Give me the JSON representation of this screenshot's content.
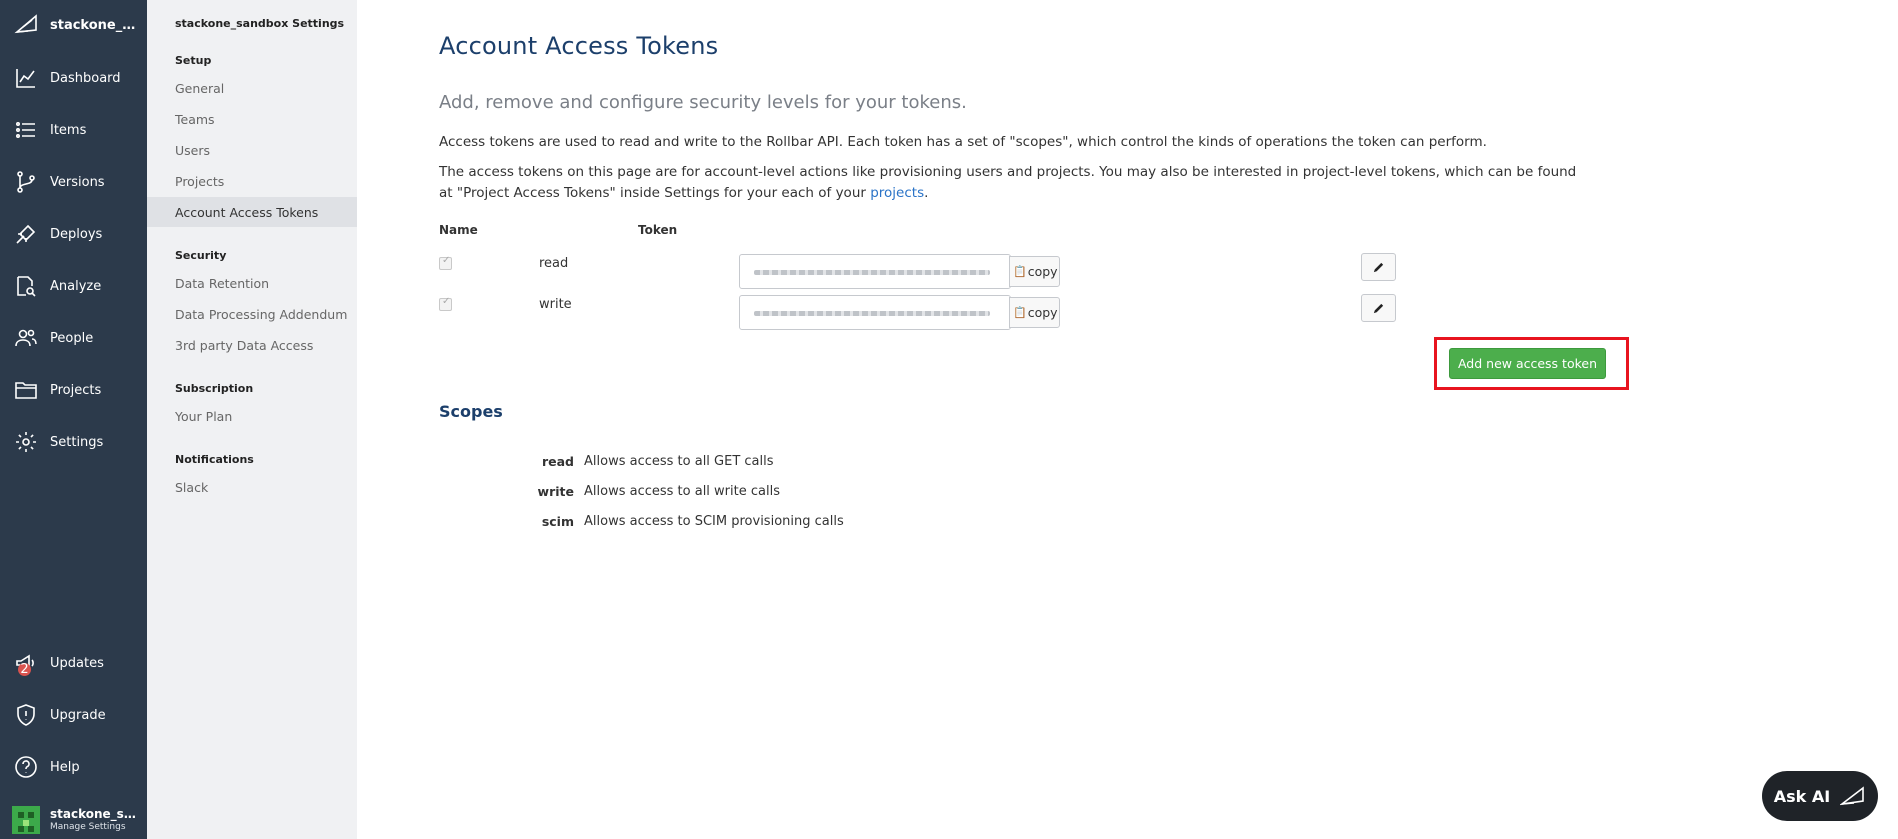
{
  "nav": {
    "org_name": "stackone_sandbox",
    "items": [
      {
        "label": "Dashboard",
        "icon": "chart-line-icon"
      },
      {
        "label": "Items",
        "icon": "list-icon"
      },
      {
        "label": "Versions",
        "icon": "git-branch-icon"
      },
      {
        "label": "Deploys",
        "icon": "rocket-icon"
      },
      {
        "label": "Analyze",
        "icon": "magnify-doc-icon"
      },
      {
        "label": "People",
        "icon": "people-icon"
      },
      {
        "label": "Projects",
        "icon": "folder-icon"
      },
      {
        "label": "Settings",
        "icon": "gear-icon"
      }
    ],
    "bottom": [
      {
        "label": "Updates",
        "icon": "megaphone-icon",
        "badge": "2"
      },
      {
        "label": "Upgrade",
        "icon": "shield-icon"
      },
      {
        "label": "Help",
        "icon": "help-icon"
      }
    ],
    "user": {
      "name": "stackone_sandbox",
      "sub": "Manage Settings"
    }
  },
  "settings": {
    "title": "stackone_sandbox Settings",
    "sections": [
      {
        "name": "Setup",
        "links": [
          "General",
          "Teams",
          "Users",
          "Projects",
          "Account Access Tokens"
        ]
      },
      {
        "name": "Security",
        "links": [
          "Data Retention",
          "Data Processing Addendum",
          "3rd party Data Access"
        ]
      },
      {
        "name": "Subscription",
        "links": [
          "Your Plan"
        ]
      },
      {
        "name": "Notifications",
        "links": [
          "Slack"
        ]
      }
    ],
    "active": "Account Access Tokens"
  },
  "main": {
    "title": "Account Access Tokens",
    "subtitle": "Add, remove and configure security levels for your tokens.",
    "para1": "Access tokens are used to read and write to the Rollbar API. Each token has a set of \"scopes\", which control the kinds of operations the token can perform.",
    "para2_a": "The access tokens on this page are for account-level actions like provisioning users and projects. You may also be interested in project-level tokens, which can be found at \"Project Access Tokens\" inside Settings for your each of your ",
    "para2_link": "projects",
    "para2_b": ".",
    "columns": {
      "name": "Name",
      "token": "Token"
    },
    "tokens": [
      {
        "name": "read",
        "checked": true,
        "copy_label": "copy"
      },
      {
        "name": "write",
        "checked": true,
        "copy_label": "copy"
      }
    ],
    "add_button": "Add new access token",
    "scopes_title": "Scopes",
    "scopes": [
      {
        "name": "read",
        "desc": "Allows access to all GET calls"
      },
      {
        "name": "write",
        "desc": "Allows access to all write calls"
      },
      {
        "name": "scim",
        "desc": "Allows access to SCIM provisioning calls"
      }
    ]
  },
  "ask_ai": "Ask AI",
  "colors": {
    "nav_bg": "#2c3a4b",
    "accent": "#1c3f6b",
    "add_button": "#4cae4c",
    "highlight": "#e8141f"
  }
}
